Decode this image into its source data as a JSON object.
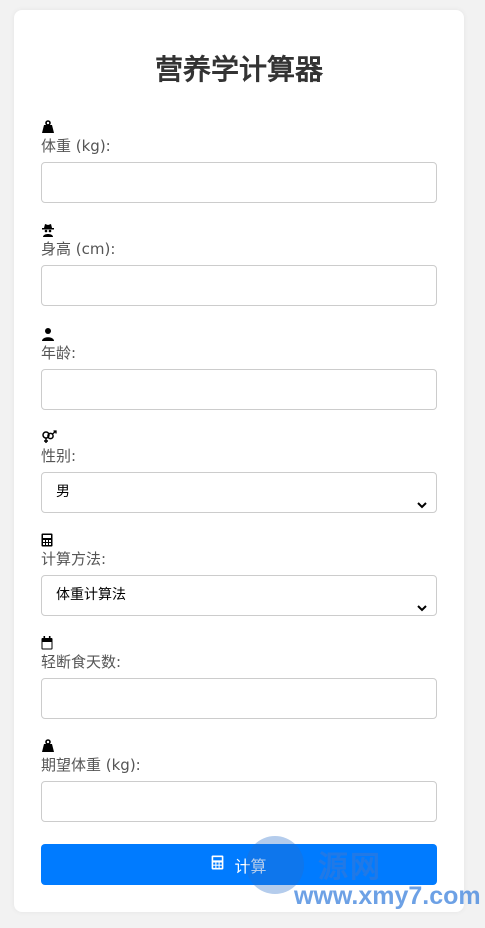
{
  "page": {
    "title": "营养学计算器"
  },
  "fields": {
    "weight": {
      "icon": "weight-icon",
      "label": "体重 (kg):",
      "value": ""
    },
    "height": {
      "icon": "user-secret-icon",
      "label": "身高 (cm):",
      "value": ""
    },
    "age": {
      "icon": "user-icon",
      "label": "年龄:",
      "value": ""
    },
    "gender": {
      "icon": "venus-mars-icon",
      "label": "性别:",
      "selected": "男"
    },
    "method": {
      "icon": "calculator-icon",
      "label": "计算方法:",
      "selected": "体重计算法"
    },
    "fasting_days": {
      "icon": "calendar-icon",
      "label": "轻断食天数:",
      "value": ""
    },
    "target_weight": {
      "icon": "weight-icon",
      "label": "期望体重 (kg):",
      "value": ""
    }
  },
  "button": {
    "label": "计算",
    "icon": "calculator-icon",
    "color": "#007bff"
  },
  "watermark": {
    "text": "源网",
    "url": "www.xmy7.com"
  }
}
